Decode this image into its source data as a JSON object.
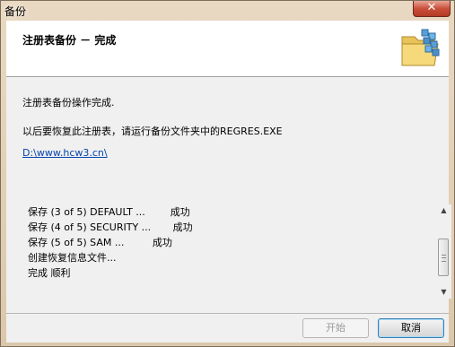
{
  "window": {
    "title": "备份",
    "close_label": "✕"
  },
  "header": {
    "title": "注册表备份 － 完成",
    "icon": "folder-registry-icon"
  },
  "body": {
    "message1": "注册表备份操作完成.",
    "message2": "以后要恢复此注册表，请运行备份文件夹中的REGRES.EXE",
    "link": "D:\\www.hcw3.cn\\"
  },
  "log": {
    "lines": [
      "保存 (3 of 5) DEFAULT ...        成功",
      "保存 (4 of 5) SECURITY ...       成功",
      "保存 (5 of 5) SAM ...         成功",
      "创建恢复信息文件...",
      "完成 顺利"
    ]
  },
  "buttons": {
    "back": "开始",
    "cancel": "取消"
  }
}
